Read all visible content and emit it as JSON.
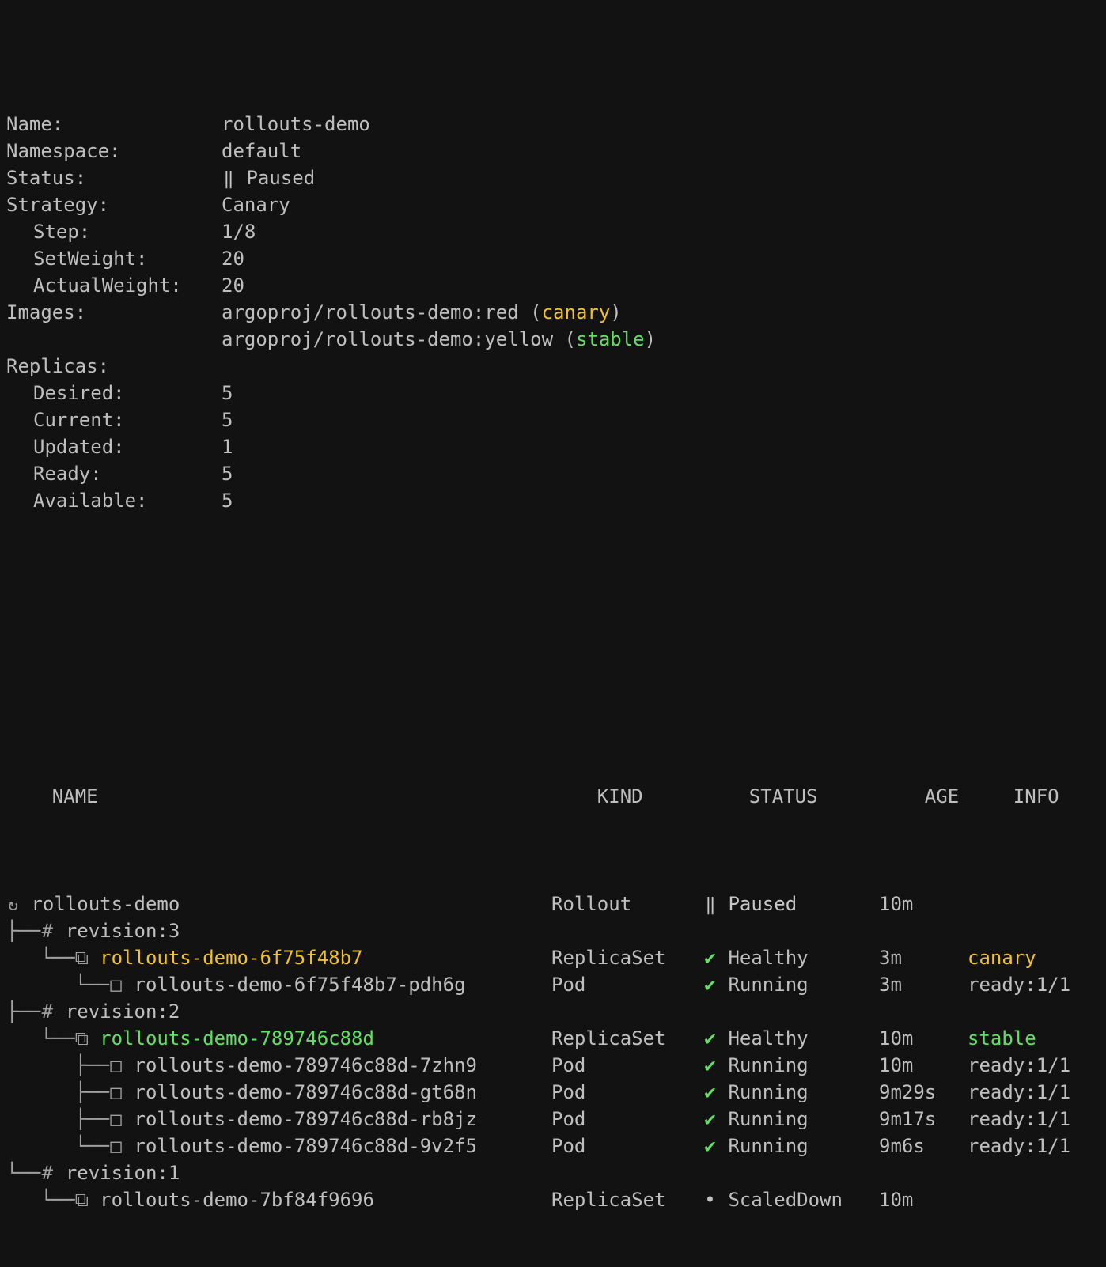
{
  "terminal": {
    "background": "#121212",
    "foreground": "#bfbfbf",
    "canary_color": "#f2c229",
    "stable_color": "#63e063",
    "tree_color": "#a0a0a0"
  },
  "summary": {
    "rows": [
      {
        "key": "Name:",
        "value": "rollouts-demo"
      },
      {
        "key": "Namespace:",
        "value": "default"
      },
      {
        "key": "Status:",
        "value": "Paused",
        "icon": "pause-icon"
      },
      {
        "key": "Strategy:",
        "value": "Canary"
      },
      {
        "key": "Step:",
        "value": "1/8",
        "indent": true
      },
      {
        "key": "SetWeight:",
        "value": "20",
        "indent": true
      },
      {
        "key": "ActualWeight:",
        "value": "20",
        "indent": true
      }
    ],
    "images_key": "Images:",
    "images": [
      {
        "image": "argoproj/rollouts-demo:red",
        "tag_open": "(",
        "tag": "canary",
        "tag_close": ")",
        "tag_kind": "canary"
      },
      {
        "image": "argoproj/rollouts-demo:yellow",
        "tag_open": "(",
        "tag": "stable",
        "tag_close": ")",
        "tag_kind": "stable"
      }
    ],
    "replicas_key": "Replicas:",
    "replicas": [
      {
        "key": "Desired:",
        "value": "5"
      },
      {
        "key": "Current:",
        "value": "5"
      },
      {
        "key": "Updated:",
        "value": "1"
      },
      {
        "key": "Ready:",
        "value": "5"
      },
      {
        "key": "Available:",
        "value": "5"
      }
    ]
  },
  "table": {
    "headers": {
      "name": "NAME",
      "kind": "KIND",
      "status": "STATUS",
      "age": "AGE",
      "info": "INFO"
    },
    "rows": [
      {
        "tree": "",
        "icon": "rollout-icon",
        "icon_glyph": "↻",
        "name": "rollouts-demo",
        "name_color": "grey",
        "kind": "Rollout",
        "status_icon": "pause-icon",
        "status_glyph": "‖",
        "status": "Paused",
        "status_color": "white",
        "age": "10m",
        "info": "",
        "info_color": "grey"
      },
      {
        "tree": "├──",
        "icon": "hash-icon",
        "icon_glyph": "#",
        "name": "revision:3",
        "name_color": "grey",
        "kind": "",
        "status_glyph": "",
        "status": "",
        "age": "",
        "info": ""
      },
      {
        "tree": "   └──",
        "icon": "replicaset-icon",
        "icon_glyph": "⧉",
        "name": "rollouts-demo-6f75f48b7",
        "name_color": "canary",
        "kind": "ReplicaSet",
        "status_icon": "check-icon",
        "status_glyph": "✔",
        "status": "Healthy",
        "status_color": "grey",
        "age": "3m",
        "info": "canary",
        "info_color": "canary"
      },
      {
        "tree": "      └──",
        "icon": "pod-icon",
        "icon_glyph": "□",
        "name": "rollouts-demo-6f75f48b7-pdh6g",
        "name_color": "grey",
        "kind": "Pod",
        "status_icon": "check-icon",
        "status_glyph": "✔",
        "status": "Running",
        "status_color": "grey",
        "age": "3m",
        "info": "ready:1/1",
        "info_color": "grey"
      },
      {
        "tree": "├──",
        "icon": "hash-icon",
        "icon_glyph": "#",
        "name": "revision:2",
        "name_color": "grey",
        "kind": "",
        "status_glyph": "",
        "status": "",
        "age": "",
        "info": ""
      },
      {
        "tree": "   └──",
        "icon": "replicaset-icon",
        "icon_glyph": "⧉",
        "name": "rollouts-demo-789746c88d",
        "name_color": "stable",
        "kind": "ReplicaSet",
        "status_icon": "check-icon",
        "status_glyph": "✔",
        "status": "Healthy",
        "status_color": "grey",
        "age": "10m",
        "info": "stable",
        "info_color": "stable"
      },
      {
        "tree": "      ├──",
        "icon": "pod-icon",
        "icon_glyph": "□",
        "name": "rollouts-demo-789746c88d-7zhn9",
        "name_color": "grey",
        "kind": "Pod",
        "status_icon": "check-icon",
        "status_glyph": "✔",
        "status": "Running",
        "status_color": "grey",
        "age": "10m",
        "info": "ready:1/1",
        "info_color": "grey"
      },
      {
        "tree": "      ├──",
        "icon": "pod-icon",
        "icon_glyph": "□",
        "name": "rollouts-demo-789746c88d-gt68n",
        "name_color": "grey",
        "kind": "Pod",
        "status_icon": "check-icon",
        "status_glyph": "✔",
        "status": "Running",
        "status_color": "grey",
        "age": "9m29s",
        "info": "ready:1/1",
        "info_color": "grey"
      },
      {
        "tree": "      ├──",
        "icon": "pod-icon",
        "icon_glyph": "□",
        "name": "rollouts-demo-789746c88d-rb8jz",
        "name_color": "grey",
        "kind": "Pod",
        "status_icon": "check-icon",
        "status_glyph": "✔",
        "status": "Running",
        "status_color": "grey",
        "age": "9m17s",
        "info": "ready:1/1",
        "info_color": "grey"
      },
      {
        "tree": "      └──",
        "icon": "pod-icon",
        "icon_glyph": "□",
        "name": "rollouts-demo-789746c88d-9v2f5",
        "name_color": "grey",
        "kind": "Pod",
        "status_icon": "check-icon",
        "status_glyph": "✔",
        "status": "Running",
        "status_color": "grey",
        "age": "9m6s",
        "info": "ready:1/1",
        "info_color": "grey"
      },
      {
        "tree": "└──",
        "icon": "hash-icon",
        "icon_glyph": "#",
        "name": "revision:1",
        "name_color": "grey",
        "kind": "",
        "status_glyph": "",
        "status": "",
        "age": "",
        "info": ""
      },
      {
        "tree": "   └──",
        "icon": "replicaset-icon",
        "icon_glyph": "⧉",
        "name": "rollouts-demo-7bf84f9696",
        "name_color": "grey",
        "kind": "ReplicaSet",
        "status_icon": "dot-icon",
        "status_glyph": "•",
        "status": "ScaledDown",
        "status_color": "grey",
        "age": "10m",
        "info": "",
        "info_color": "grey"
      }
    ]
  }
}
